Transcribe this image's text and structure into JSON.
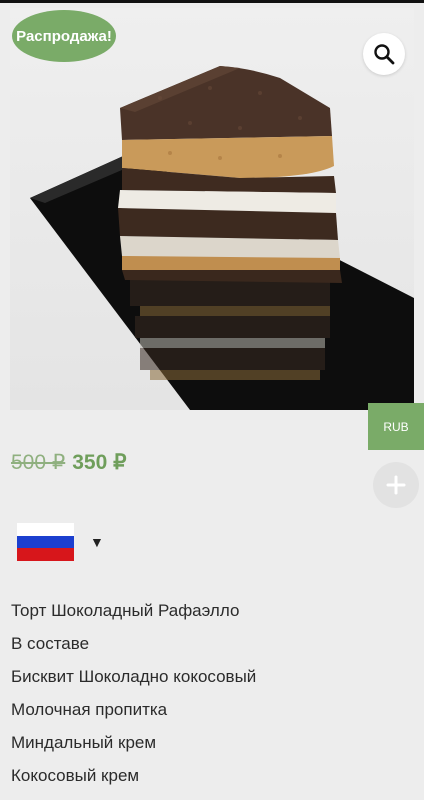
{
  "product": {
    "image_alt": "Торт Шоколадный Рафаэлло",
    "sale_badge": "Распродажа!",
    "old_price": "500 ₽",
    "new_price": "350 ₽",
    "currency": "RUB"
  },
  "language": {
    "selected": "Русский",
    "flag_colors": [
      "#ffffff",
      "#1c3fcf",
      "#d7161b"
    ],
    "dropdown_glyph": "▼"
  },
  "description": [
    "Торт Шоколадный Рафаэлло",
    "В составе",
    "Бисквит Шоколадно кокосовый",
    "Молочная пропитка",
    "Миндальный крем",
    "Кокосовый крем"
  ],
  "icons": {
    "zoom": "magnifier-icon",
    "add": "plus-icon"
  },
  "colors": {
    "accent": "#7aab68",
    "price": "#6f9e5b",
    "background": "#ededed"
  }
}
